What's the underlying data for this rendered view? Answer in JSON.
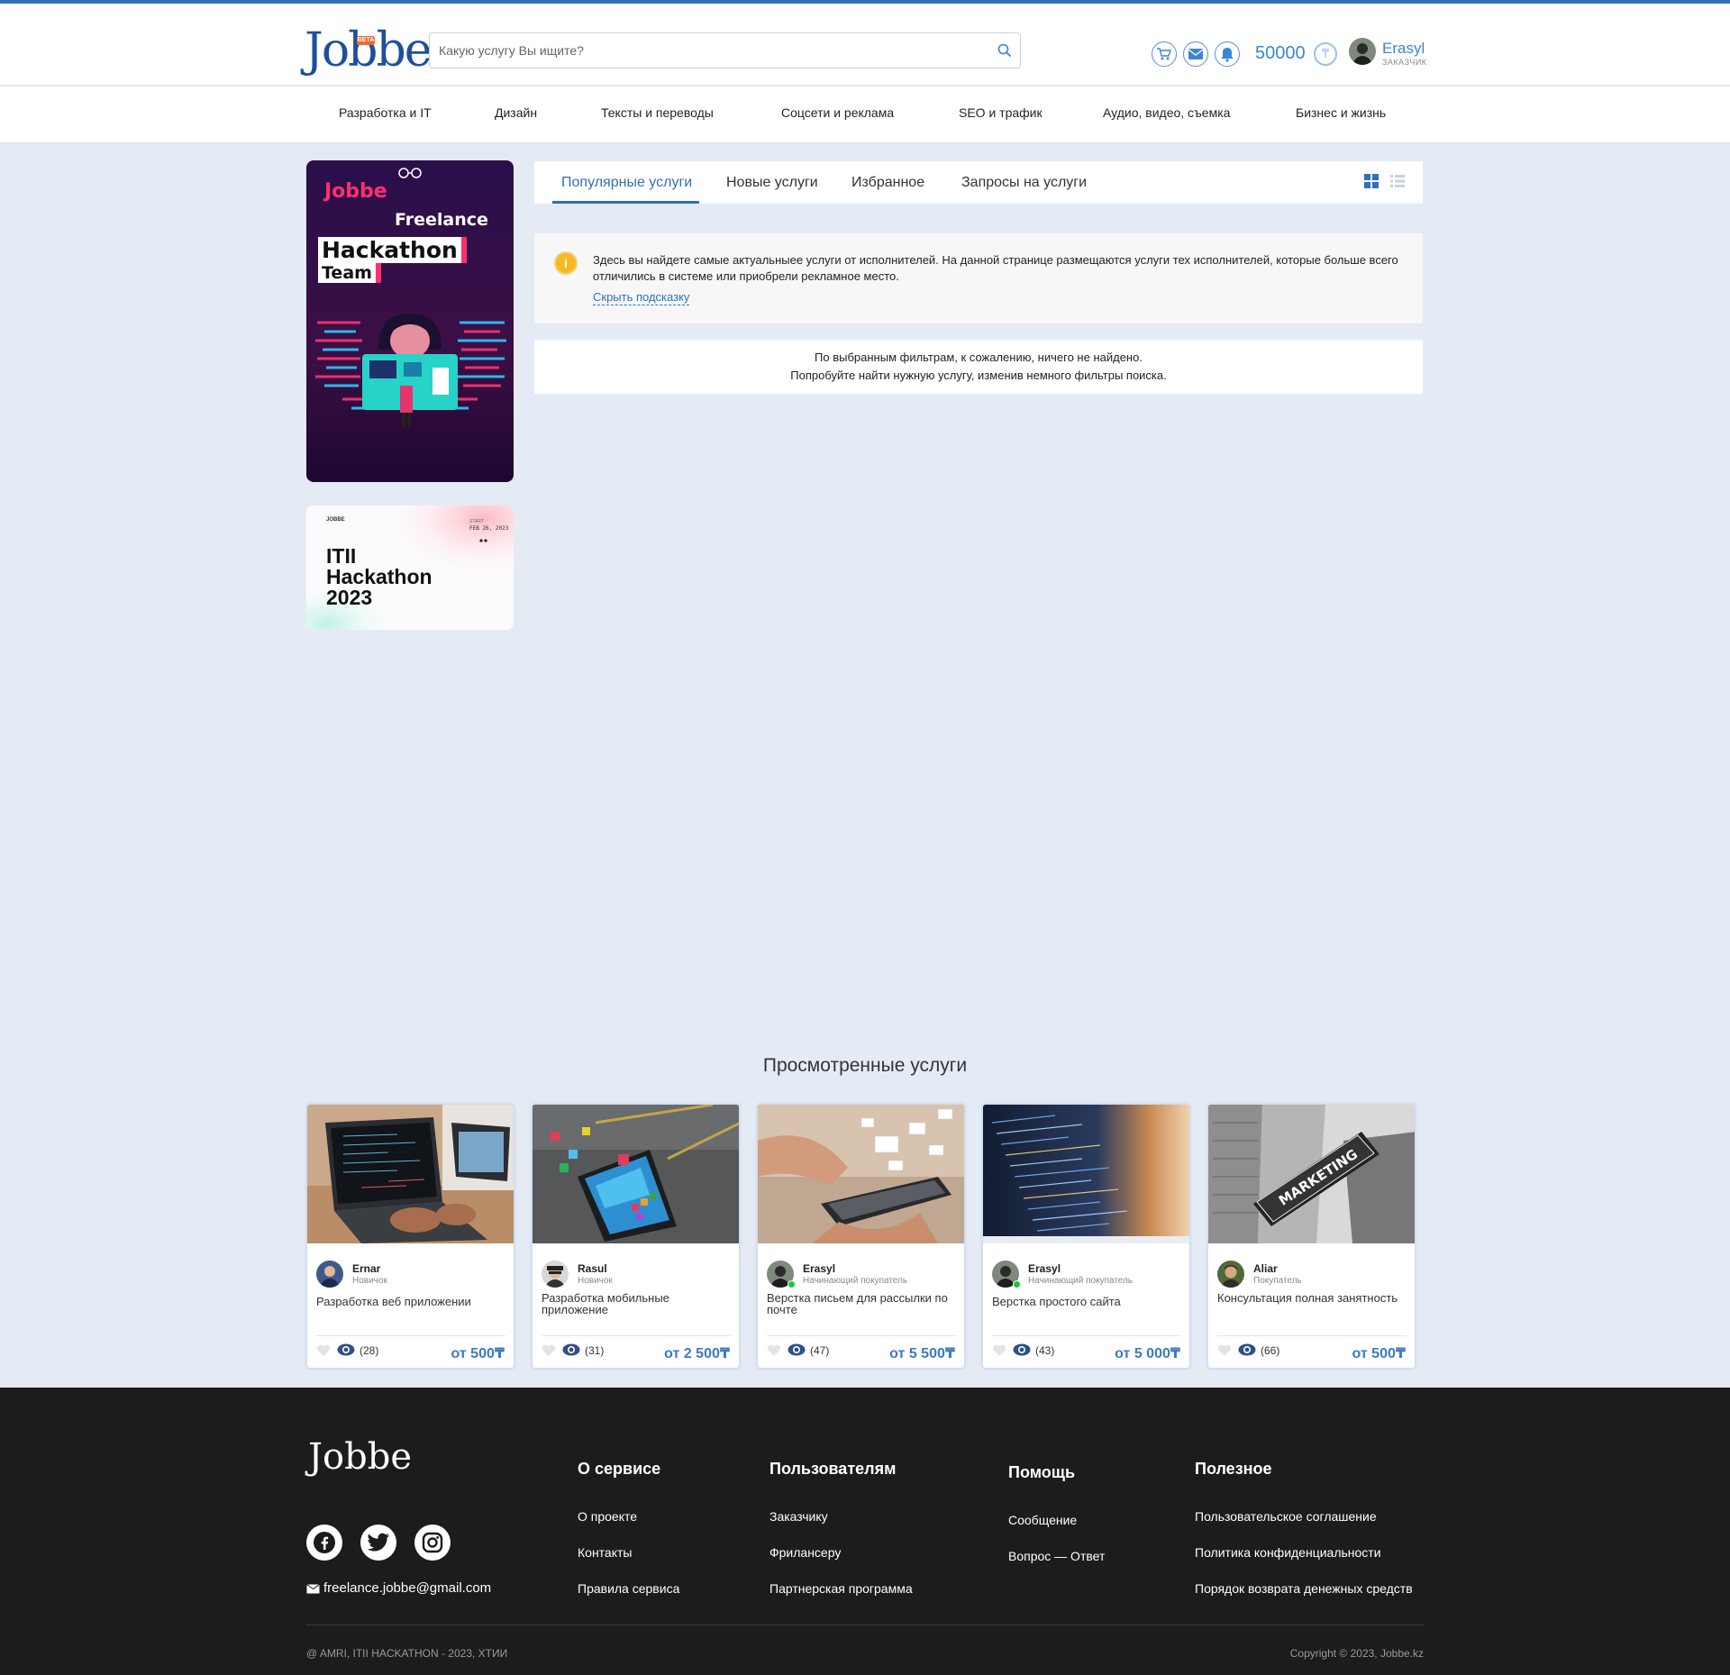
{
  "header": {
    "logo_text": "Jobbe",
    "logo_badge": "BETA",
    "search_placeholder": "Какую услугу Вы ищите?",
    "balance": "50000",
    "currency_symbol": "₸",
    "user": {
      "name": "Erasyl",
      "role": "ЗАКАЗЧИК"
    }
  },
  "categories": [
    "Разработка и IT",
    "Дизайн",
    "Тексты и переводы",
    "Соцсети и реклама",
    "SEO и трафик",
    "Аудио, видео, съемка",
    "Бизнес и жизнь"
  ],
  "banners": {
    "hackathon_team": {
      "line1": "Jobbe",
      "line2": "Freelance",
      "line3": "Hackathon",
      "line4": "Team"
    },
    "itii": {
      "brand": "JOBBE",
      "small_label": "START",
      "date": "FEB 26, 2023",
      "title_line1": "ITII",
      "title_line2": "Hackathon",
      "title_line3": "2023"
    }
  },
  "tabs": [
    "Популярные услуги",
    "Новые услуги",
    "Избранное",
    "Запросы на услуги"
  ],
  "hint": {
    "text": "Здесь вы найдете самые актуальныее услуги от исполнителей. На данной странице размещаются услуги тех исполнителей, которые больше всего отличились в системе или приобрели рекламное место.",
    "hide_link": "Скрыть подсказку"
  },
  "not_found": {
    "line1": "По выбранным фильтрам, к сожалению, ничего не найдено.",
    "line2": "Попробуйте найти нужную услугу, изменив немного фильтры поиска."
  },
  "viewed": {
    "title": "Просмотренные услуги",
    "cards": [
      {
        "author": "Ernar",
        "level": "Новичок",
        "title": "Разработка веб приложении",
        "views": "(28)",
        "price": "от 500₸",
        "online": false
      },
      {
        "author": "Rasul",
        "level": "Новичок",
        "title": "Разработка мобильные приложение",
        "views": "(31)",
        "price": "от 2 500₸",
        "online": false
      },
      {
        "author": "Erasyl",
        "level": "Начинающий покупатель",
        "title": "Верстка письем для рассылки по почте",
        "views": "(47)",
        "price": "от 5 500₸",
        "online": true
      },
      {
        "author": "Erasyl",
        "level": "Начинающий покупатель",
        "title": "Верстка простого сайта",
        "views": "(43)",
        "price": "от 5 000₸",
        "online": true
      },
      {
        "author": "Aliar",
        "level": "Покупатель",
        "title": "Консультация полная занятность",
        "views": "(66)",
        "price": "от 500₸",
        "online": false
      }
    ]
  },
  "footer": {
    "logo_text": "Jobbe",
    "email": "freelance.jobbe@gmail.com",
    "columns": [
      {
        "title": "О сервисе",
        "links": [
          "О проекте",
          "Контакты",
          "Правила сервиса"
        ]
      },
      {
        "title": "Пользователям",
        "links": [
          "Заказчику",
          "Фрилансеру",
          "Партнерская программа"
        ]
      },
      {
        "title": "Помощь",
        "links": [
          "Сообщение",
          "Вопрос — Ответ"
        ]
      },
      {
        "title": "Полезное",
        "links": [
          "Пользовательское соглашение",
          "Политика конфиденциальности",
          "Порядок возврата денежных средств"
        ]
      }
    ],
    "copyright_left": "@ AMRI, ITII HACKATHON - 2023, ХТИИ",
    "copyright_right": "Copyright © 2023, Jobbe.kz"
  },
  "colors": {
    "accent": "#2f6fbf",
    "page_bg": "#e5ebf5",
    "footer_bg": "#1c1c1e",
    "price": "#3d79c6",
    "hint_icon": "#f5b921"
  }
}
